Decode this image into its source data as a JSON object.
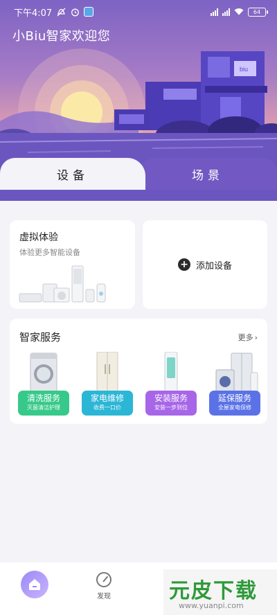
{
  "status_bar": {
    "time": "下午4:07",
    "icons": [
      "mute-icon",
      "alarm-icon",
      "app-icon"
    ],
    "battery": "64"
  },
  "greeting": "小Biu智家欢迎您",
  "tabs": [
    {
      "label": "设备",
      "active": true
    },
    {
      "label": "场景",
      "active": false
    }
  ],
  "virtual_card": {
    "title": "虚拟体验",
    "subtitle": "体验更多智能设备"
  },
  "add_device": {
    "label": "添加设备",
    "icon": "plus-icon"
  },
  "services": {
    "title": "智家服务",
    "more_label": "更多",
    "items": [
      {
        "name": "清洗服务",
        "desc": "灭菌清洁护理",
        "color": "#37c98a",
        "icon": "washing-machine-icon"
      },
      {
        "name": "家电维修",
        "desc": "收费一口价",
        "color": "#2cb6d6",
        "icon": "refrigerator-icon"
      },
      {
        "name": "安装服务",
        "desc": "安装一步到位",
        "color": "#a766e8",
        "icon": "air-conditioner-icon"
      },
      {
        "name": "延保服务",
        "desc": "全屋家电保修",
        "color": "#5b72e6",
        "icon": "appliances-icon"
      }
    ]
  },
  "bottom_nav": {
    "discover_label": "发现"
  },
  "watermark": {
    "logo": "元皮下载",
    "url": "www.yuanpi.com"
  },
  "colors": {
    "hero_top": "#7d63c4",
    "tab_inactive": "#7158c2",
    "background": "#f3f3f8"
  }
}
